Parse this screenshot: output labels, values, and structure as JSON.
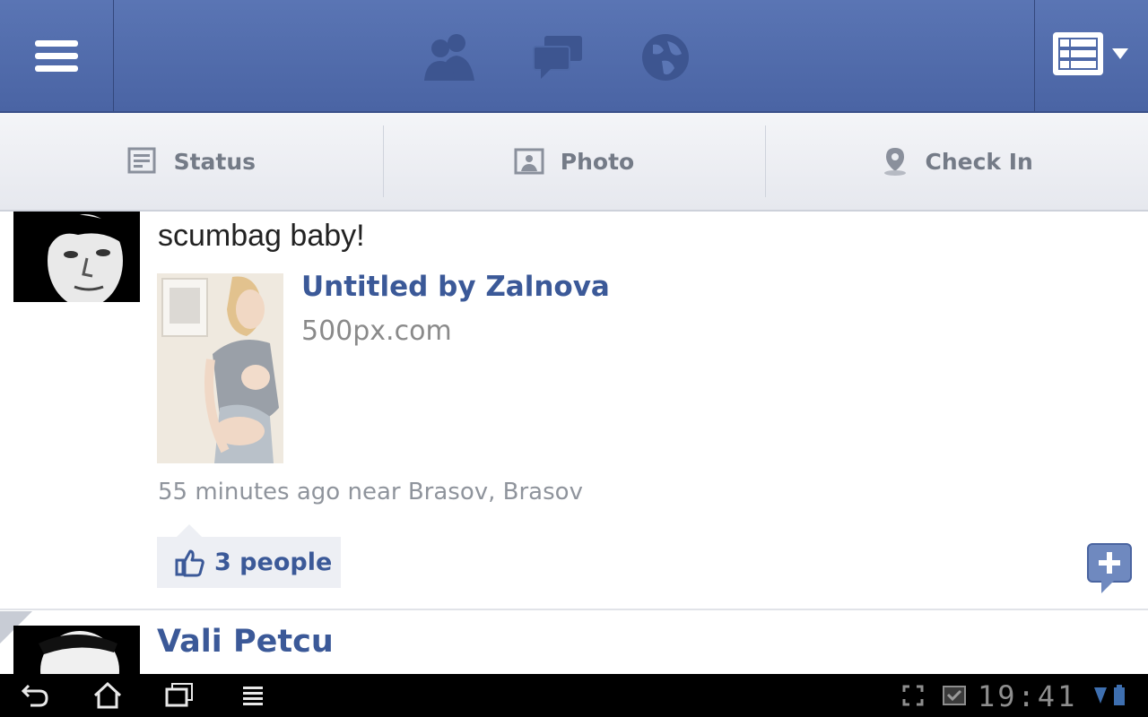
{
  "app": {
    "brand_color": "#4e69a8",
    "link_color": "#3b5998"
  },
  "topbar": {
    "menu_icon": "menu-icon",
    "jewels": [
      "friend-requests-icon",
      "messages-icon",
      "notifications-globe-icon"
    ],
    "feed_filter_icon": "news-feed-list-icon"
  },
  "publisher": {
    "status_label": "Status",
    "photo_label": "Photo",
    "checkin_label": "Check In"
  },
  "story": {
    "message": "scumbag baby!",
    "link_title": "Untitled by Zalnova",
    "link_domain": "500px.com",
    "timestamp": "55 minutes ago near Brasov, Brasov",
    "likes_label": "3 people"
  },
  "next_story": {
    "author": "Vali Petcu"
  },
  "system_bar": {
    "clock": "19:41",
    "buttons": [
      "back-icon",
      "home-icon",
      "recent-apps-icon",
      "menu-icon"
    ]
  }
}
